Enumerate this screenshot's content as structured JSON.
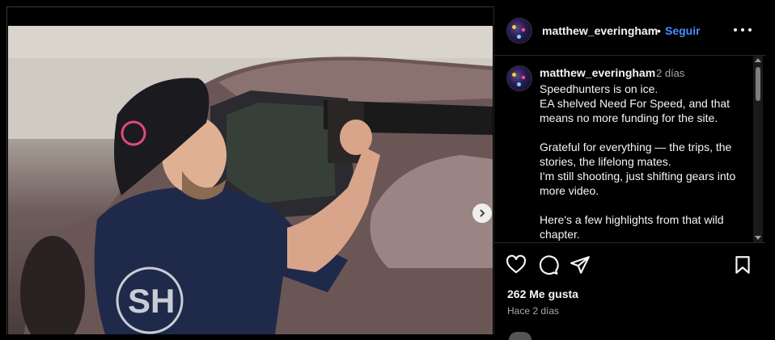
{
  "post": {
    "username": "matthew_everingham",
    "separator": "•",
    "follow_label": "Seguir",
    "more_label": "Más opciones"
  },
  "caption": {
    "username": "matthew_everingham",
    "time": "2 días",
    "lines": [
      "Speedhunters is on ice.",
      "EA shelved Need For Speed, and that means no more funding for the site.",
      "",
      "Grateful for everything — the trips, the stories, the lifelong mates.",
      "I'm still shooting, just shifting gears into more video.",
      "",
      "Here's a few highlights from that wild chapter."
    ]
  },
  "stats": {
    "likes": "262 Me gusta",
    "posted": "Hace 2 días"
  },
  "icons": {
    "like": "heart-icon",
    "comment": "comment-icon",
    "share": "paper-plane-icon",
    "save": "bookmark-icon",
    "next": "chevron-right-icon"
  },
  "colors": {
    "follow": "#4a8cff",
    "background": "#000000",
    "secondary_text": "#a8a8a8"
  }
}
